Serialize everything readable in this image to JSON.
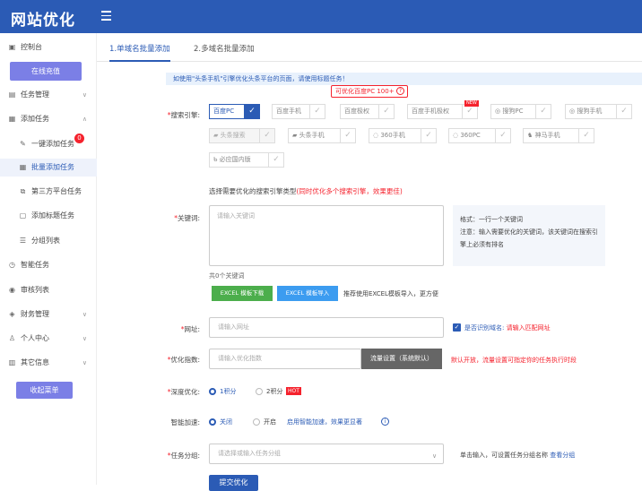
{
  "app": {
    "logo": "网站优化"
  },
  "sidebar": {
    "recharge": "在线充值",
    "collect": "收起菜单",
    "badge": "0",
    "items": [
      {
        "label": "控制台"
      },
      {
        "label": "任务管理"
      },
      {
        "label": "添加任务"
      },
      {
        "label": "一键添加任务"
      },
      {
        "label": "批量添加任务"
      },
      {
        "label": "第三方平台任务"
      },
      {
        "label": "添加标题任务"
      },
      {
        "label": "分组列表"
      },
      {
        "label": "智能任务"
      },
      {
        "label": "审核列表"
      },
      {
        "label": "财务管理"
      },
      {
        "label": "个人中心"
      },
      {
        "label": "其它信息"
      }
    ]
  },
  "tabs": [
    {
      "label": "1.单域名批量添加"
    },
    {
      "label": "2.多域名批量添加"
    }
  ],
  "notice": "如使用\"头条手机\"引擎优化头条平台的页面，请使用标题任务！",
  "tooltip": "可优化百度PC 100+",
  "form": {
    "engine_label": "搜索引擎:",
    "engines": [
      {
        "label": "百度PC"
      },
      {
        "label": "百度手机"
      },
      {
        "label": "百度极权"
      },
      {
        "label": "百度手机极权"
      },
      {
        "label": "搜狗PC"
      },
      {
        "label": "搜狗手机"
      },
      {
        "label": "头条搜索"
      },
      {
        "label": "头条手机"
      },
      {
        "label": "360手机"
      },
      {
        "label": "360PC"
      },
      {
        "label": "神马手机"
      },
      {
        "label": "必应国内版"
      }
    ],
    "new_tag": "NEW",
    "engine_hint": "选择需要优化的搜索引擎类型",
    "engine_hint_red": "(同时优化多个搜索引擎，效果更佳)",
    "keyword_label": "关键词:",
    "keyword_placeholder": "请输入关键词",
    "format_title": "格式：一行一个关键词",
    "format_note": "注意：输入需要优化的关键词，该关键词在搜索引擎上必须有排名",
    "kw_count": "共0个关键词",
    "excel_download": "EXCEL 模板下载",
    "excel_import": "EXCEL 模板导入",
    "excel_tip": "推荐使用EXCEL模板导入，更方便",
    "url_label": "网址:",
    "url_placeholder": "请输入网址",
    "url_check": "是否识别域名:",
    "url_check_red": "请输入匹配网址",
    "index_label": "优化指数:",
    "index_placeholder": "请输入优化指数",
    "flow_btn": "流量设置（系统默认）",
    "flow_tip": "默认开放，流量设置可指定你的任务执行时段",
    "depth_label": "深度优化:",
    "depth_opt1": "1积分",
    "depth_opt2": "2积分",
    "hot": "HOT",
    "smart_label": "智能加速:",
    "smart_off": "关闭",
    "smart_on": "开启",
    "smart_tip": "启用智能加速，效果更显著",
    "group_label": "任务分组:",
    "group_placeholder": "请选择或输入任务分组",
    "group_tip": "单击输入，可设置任务分组名称",
    "group_link": "查看分组",
    "submit": "提交优化"
  }
}
